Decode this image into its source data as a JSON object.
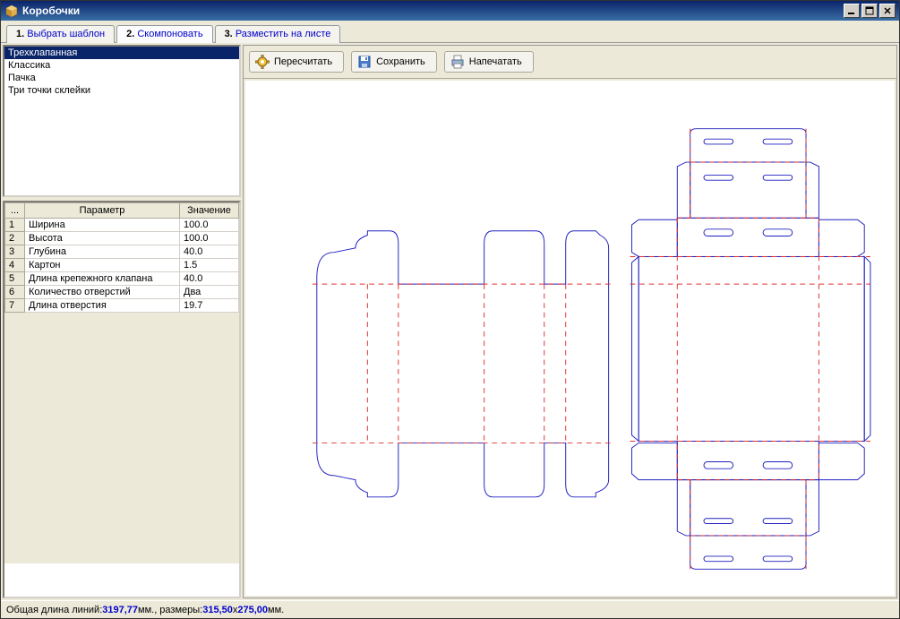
{
  "window": {
    "title": "Коробочки"
  },
  "tabs": [
    {
      "num": "1.",
      "label": "Выбрать шаблон",
      "active": false
    },
    {
      "num": "2.",
      "label": "Скомпоновать",
      "active": true
    },
    {
      "num": "3.",
      "label": "Разместить на листе",
      "active": false
    }
  ],
  "templates": [
    {
      "label": "Трехклапанная",
      "selected": true
    },
    {
      "label": "Классика",
      "selected": false
    },
    {
      "label": "Пачка",
      "selected": false
    },
    {
      "label": "Три точки склейки",
      "selected": false
    }
  ],
  "param_header": {
    "idx": "...",
    "name": "Параметр",
    "value": "Значение"
  },
  "params": [
    {
      "idx": "1",
      "name": "Ширина",
      "value": "100.0"
    },
    {
      "idx": "2",
      "name": "Высота",
      "value": "100.0"
    },
    {
      "idx": "3",
      "name": "Глубина",
      "value": "40.0"
    },
    {
      "idx": "4",
      "name": "Картон",
      "value": "1.5"
    },
    {
      "idx": "5",
      "name": "Длина крепежного клапана",
      "value": "40.0"
    },
    {
      "idx": "6",
      "name": "Количество отверстий",
      "value": "Два"
    },
    {
      "idx": "7",
      "name": "Длина отверстия",
      "value": "19.7"
    }
  ],
  "toolbar": {
    "recalc": "Пересчитать",
    "save": "Сохранить",
    "print": "Напечатать"
  },
  "status": {
    "line_prefix": "Общая длина линий: ",
    "line_val": "3197,77",
    "line_suffix": " мм., размеры: ",
    "w": "315,50",
    "sep": " x ",
    "h": "275,00",
    "end": " мм."
  }
}
